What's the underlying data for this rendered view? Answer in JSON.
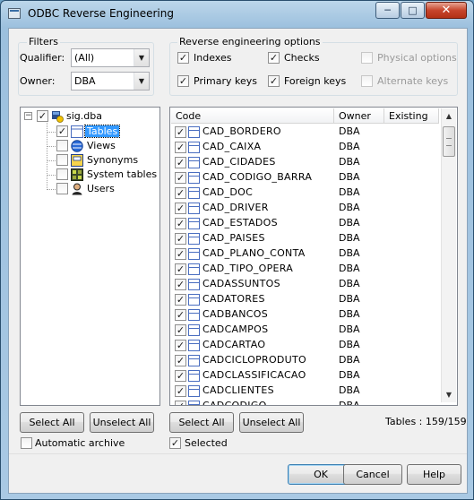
{
  "window": {
    "title": "ODBC Reverse Engineering",
    "minimize": "─",
    "maximize": "□",
    "close": "✕"
  },
  "filters": {
    "group_label": "Filters",
    "qualifier_label": "Qualifier:",
    "qualifier_value": "(All)",
    "owner_label": "Owner:",
    "owner_value": "DBA"
  },
  "options": {
    "group_label": "Reverse engineering options",
    "indexes": {
      "label": "Indexes",
      "checked": true
    },
    "checks": {
      "label": "Checks",
      "checked": true
    },
    "physical_options": {
      "label": "Physical options",
      "checked": false,
      "disabled": true
    },
    "primary_keys": {
      "label": "Primary keys",
      "checked": true
    },
    "foreign_keys": {
      "label": "Foreign keys",
      "checked": true
    },
    "alternate_keys": {
      "label": "Alternate keys",
      "checked": false,
      "disabled": true
    }
  },
  "tree": {
    "root": {
      "label": "sig.dba",
      "checked": true,
      "expander": "−"
    },
    "items": [
      {
        "label": "Tables",
        "checked": true,
        "selected": true,
        "icon": "table-icon"
      },
      {
        "label": "Views",
        "checked": false,
        "icon": "view-icon"
      },
      {
        "label": "Synonyms",
        "checked": false,
        "icon": "synonym-icon"
      },
      {
        "label": "System tables",
        "checked": false,
        "icon": "system-table-icon"
      },
      {
        "label": "Users",
        "checked": false,
        "icon": "user-icon"
      }
    ]
  },
  "table": {
    "columns": [
      "Code",
      "Owner",
      "Existing"
    ],
    "rows": [
      {
        "code": "CAD_BORDERO",
        "owner": "DBA",
        "checked": true
      },
      {
        "code": "CAD_CAIXA",
        "owner": "DBA",
        "checked": true
      },
      {
        "code": "CAD_CIDADES",
        "owner": "DBA",
        "checked": true
      },
      {
        "code": "CAD_CODIGO_BARRA",
        "owner": "DBA",
        "checked": true
      },
      {
        "code": "CAD_DOC",
        "owner": "DBA",
        "checked": true
      },
      {
        "code": "CAD_DRIVER",
        "owner": "DBA",
        "checked": true
      },
      {
        "code": "CAD_ESTADOS",
        "owner": "DBA",
        "checked": true
      },
      {
        "code": "CAD_PAISES",
        "owner": "DBA",
        "checked": true
      },
      {
        "code": "CAD_PLANO_CONTA",
        "owner": "DBA",
        "checked": true
      },
      {
        "code": "CAD_TIPO_OPERA",
        "owner": "DBA",
        "checked": true
      },
      {
        "code": "CADASSUNTOS",
        "owner": "DBA",
        "checked": true
      },
      {
        "code": "CADATORES",
        "owner": "DBA",
        "checked": true
      },
      {
        "code": "CADBANCOS",
        "owner": "DBA",
        "checked": true
      },
      {
        "code": "CADCAMPOS",
        "owner": "DBA",
        "checked": true
      },
      {
        "code": "CADCARTAO",
        "owner": "DBA",
        "checked": true
      },
      {
        "code": "CADCICLOPRODUTO",
        "owner": "DBA",
        "checked": true
      },
      {
        "code": "CADCLASSIFICACAO",
        "owner": "DBA",
        "checked": true
      },
      {
        "code": "CADCLIENTES",
        "owner": "DBA",
        "checked": true
      },
      {
        "code": "CADCODIGO",
        "owner": "DBA",
        "checked": true
      }
    ]
  },
  "left_buttons": {
    "select_all": "Select All",
    "unselect_all": "Unselect All"
  },
  "right_buttons": {
    "select_all": "Select All",
    "unselect_all": "Unselect All"
  },
  "tables_count": "Tables : 159/159",
  "automatic_archive": {
    "label": "Automatic archive",
    "checked": false
  },
  "selected": {
    "label": "Selected",
    "checked": true
  },
  "footer": {
    "ok": "OK",
    "cancel": "Cancel",
    "help": "Help"
  },
  "check_glyph": "✓"
}
